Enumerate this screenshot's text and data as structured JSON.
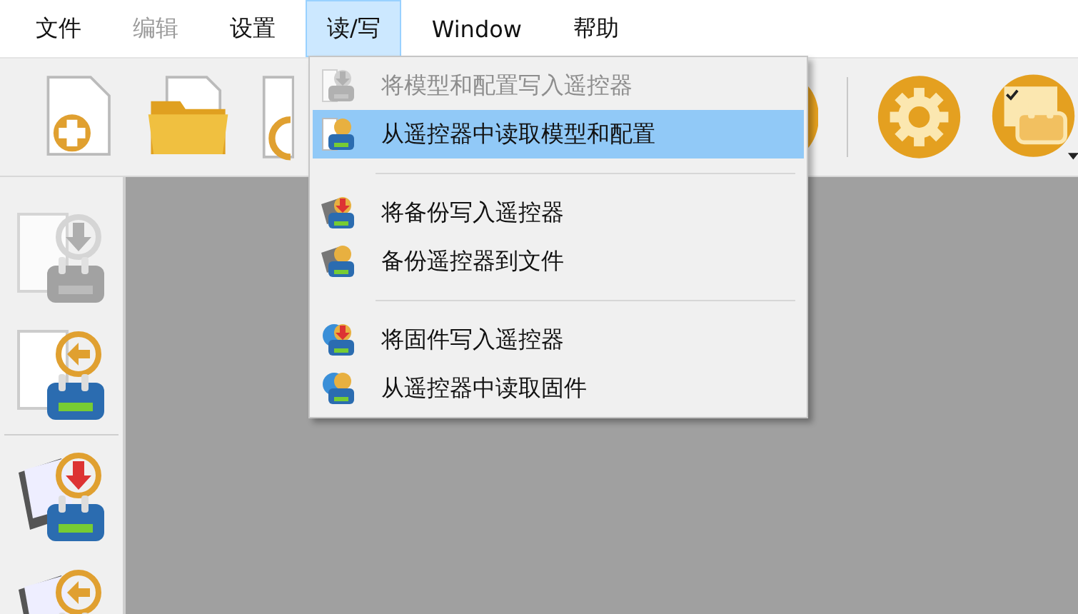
{
  "menubar": [
    {
      "label": "文件",
      "selected": false,
      "disabled": false
    },
    {
      "label": "编辑",
      "selected": false,
      "disabled": true
    },
    {
      "label": "设置",
      "selected": false,
      "disabled": false
    },
    {
      "label": "读/写",
      "selected": true,
      "disabled": false
    },
    {
      "label": "Window",
      "selected": false,
      "disabled": false
    },
    {
      "label": "帮助",
      "selected": false,
      "disabled": false
    }
  ],
  "menu": {
    "items": [
      {
        "kind": "item",
        "label": "将模型和配置写入遥控器",
        "disabled": true,
        "selected": false
      },
      {
        "kind": "item",
        "label": "从遥控器中读取模型和配置",
        "disabled": false,
        "selected": true
      },
      {
        "kind": "separator"
      },
      {
        "kind": "item",
        "label": "将备份写入遥控器",
        "disabled": false,
        "selected": false
      },
      {
        "kind": "item",
        "label": "备份遥控器到文件",
        "disabled": false,
        "selected": false
      },
      {
        "kind": "separator"
      },
      {
        "kind": "item",
        "label": "将固件写入遥控器",
        "disabled": false,
        "selected": false
      },
      {
        "kind": "item",
        "label": "从遥控器中读取固件",
        "disabled": false,
        "selected": false
      }
    ]
  },
  "side_tools": [
    {
      "kind": "tool",
      "disabled": true
    },
    {
      "kind": "tool",
      "disabled": false
    },
    {
      "kind": "separator"
    },
    {
      "kind": "tool",
      "disabled": false
    },
    {
      "kind": "tool",
      "disabled": false
    }
  ]
}
